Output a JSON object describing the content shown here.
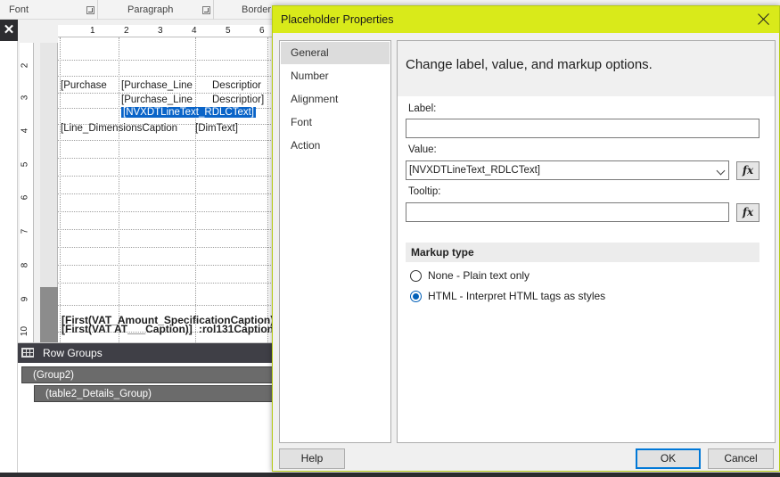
{
  "ribbon": {
    "groups": [
      "Font",
      "Paragraph",
      "Border"
    ]
  },
  "design": {
    "hruler_numbers": [
      "1",
      "2",
      "3",
      "4",
      "5",
      "6"
    ],
    "vruler_numbers": [
      "2",
      "3",
      "4",
      "5",
      "6",
      "7",
      "8",
      "9",
      "10"
    ],
    "cells": [
      "[Purchase",
      "[Purchase_Line",
      "Descriptior",
      "[Purchase_Line",
      "Descriptior]",
      "[NVXDTLineText_RDLCText]",
      "[Line_DimensionsCaption",
      "[DimText]",
      "[First(VAT_Amount_SpecificationCaption)]",
      "[First(VAT",
      "AT___Caption)]",
      ":rol131Caption"
    ]
  },
  "row_groups": {
    "title": "Row Groups",
    "items": [
      "(Group2)",
      "(table2_Details_Group)"
    ]
  },
  "dialog": {
    "title": "Placeholder Properties",
    "nav": [
      "General",
      "Number",
      "Alignment",
      "Font",
      "Action"
    ],
    "header": "Change label, value, and markup options.",
    "label_caption": "Label:",
    "label_value": "",
    "value_caption": "Value:",
    "value_value": "[NVXDTLineText_RDLCText]",
    "tooltip_caption": "Tooltip:",
    "tooltip_value": "",
    "fx_symbol": "fx",
    "markup_title": "Markup type",
    "markup_options": [
      "None - Plain text only",
      "HTML - Interpret HTML tags as styles"
    ],
    "markup_selected": "HTML - Interpret HTML tags as styles",
    "buttons": {
      "help": "Help",
      "ok": "OK",
      "cancel": "Cancel"
    }
  },
  "colors": {
    "title_bar": "#d9ea1a",
    "selection": "#0a64c8",
    "accent": "#0078d7"
  }
}
